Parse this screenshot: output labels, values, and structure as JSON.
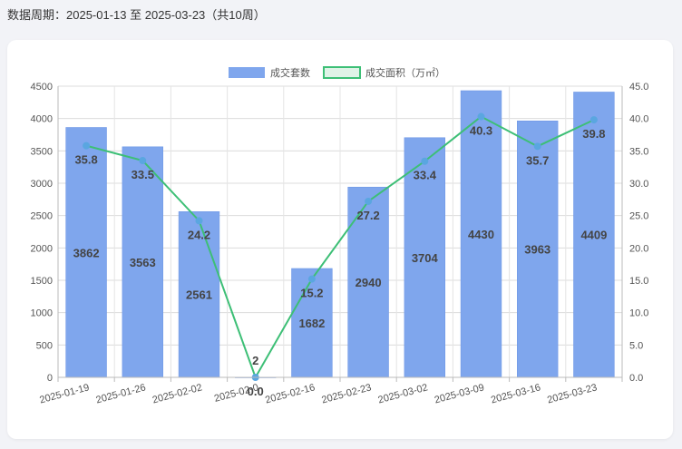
{
  "header": {
    "period_label": "数据周期：",
    "start": "2025-01-13",
    "to": "至",
    "end": "2025-03-23",
    "weeks": "（共10周）"
  },
  "colors": {
    "bar": "#7fa6ed",
    "bar_border": "#6f97e6",
    "line": "#3dbf76",
    "point": "#5aa6e0"
  },
  "chart_data": {
    "type": "bar",
    "categories": [
      "2025-01-19",
      "2025-01-26",
      "2025-02-02",
      "2025-02-09",
      "2025-02-16",
      "2025-02-23",
      "2025-03-02",
      "2025-03-09",
      "2025-03-16",
      "2025-03-23"
    ],
    "category_labels_shown": [
      "2025-01-19",
      "2025-01-26",
      "2025-02-02",
      "2025-02-0",
      "2025-02-16",
      "2025-02-23",
      "2025-03-02",
      "2025-03-09",
      "2025-03-16",
      "2025-03-23"
    ],
    "series": [
      {
        "name": "成交套数",
        "type": "bar",
        "axis": "left",
        "values": [
          3862,
          3563,
          2561,
          2,
          1682,
          2940,
          3704,
          4430,
          3963,
          4409
        ]
      },
      {
        "name": "成交面积（万㎡）",
        "type": "line",
        "axis": "right",
        "values": [
          35.8,
          33.5,
          24.2,
          0.0,
          15.2,
          27.2,
          33.4,
          40.3,
          35.7,
          39.8
        ]
      }
    ],
    "line_labels": [
      "35.8",
      "33.5",
      "24.2",
      "0.0",
      "15.2",
      "27.2",
      "33.4",
      "40.3",
      "35.7",
      "39.8"
    ],
    "yleft_ticks": [
      "0",
      "500",
      "1000",
      "1500",
      "2000",
      "2500",
      "3000",
      "3500",
      "4000",
      "4500"
    ],
    "yright_ticks": [
      "0.0",
      "5.0",
      "10.0",
      "15.0",
      "20.0",
      "25.0",
      "30.0",
      "35.0",
      "40.0",
      "45.0"
    ],
    "yleft_lim": [
      0,
      4500
    ],
    "yright_lim": [
      0,
      45
    ],
    "legend_position": "top-center",
    "grid": true
  }
}
